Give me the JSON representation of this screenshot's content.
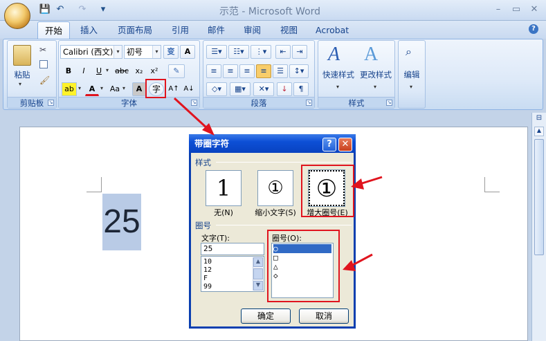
{
  "window": {
    "title": "示范 - Microsoft Word",
    "min": "–",
    "max": "▭",
    "close": "✕"
  },
  "qat": {
    "save": "💾",
    "undo": "↶",
    "redo": "↷",
    "more": "▾"
  },
  "tabs": [
    "开始",
    "插入",
    "页面布局",
    "引用",
    "邮件",
    "审阅",
    "视图",
    "Acrobat"
  ],
  "help": "?",
  "ribbon": {
    "clipboard": {
      "label": "剪贴板",
      "paste": "粘贴"
    },
    "font": {
      "label": "字体",
      "font_name": "Calibri (西文)",
      "font_size": "初号",
      "bold": "B",
      "italic": "I",
      "underline": "U",
      "strike": "abc",
      "subscript": "x₂",
      "superscript": "x²",
      "case": "Aa",
      "enclose_char": "字",
      "grow": "A↑",
      "shrink": "A↓"
    },
    "paragraph": {
      "label": "段落"
    },
    "styles": {
      "label": "样式",
      "quick_styles": "快速样式",
      "change_styles": "更改样式"
    },
    "editing": {
      "label": "编辑"
    }
  },
  "document": {
    "selected_text": "25"
  },
  "dialog": {
    "title": "带圈字符",
    "help": "?",
    "close": "✕",
    "style_section": "样式",
    "styles": [
      {
        "label": "无(N)",
        "preview": "1"
      },
      {
        "label": "缩小文字(S)",
        "preview": "①"
      },
      {
        "label": "增大圈号(E)",
        "preview": "①"
      }
    ],
    "enclosure_section": "圈号",
    "text_label": "文字(T):",
    "text_value": "25",
    "text_options": [
      "10",
      "12",
      "F",
      "99"
    ],
    "enclosure_label": "圈号(O):",
    "enclosures": [
      "○",
      "□",
      "△",
      "◇"
    ],
    "ok": "确定",
    "cancel": "取消"
  },
  "colors": {
    "highlight": "#e0141e",
    "title_bar": "#0842c0",
    "selection": "#b9cbe6"
  }
}
